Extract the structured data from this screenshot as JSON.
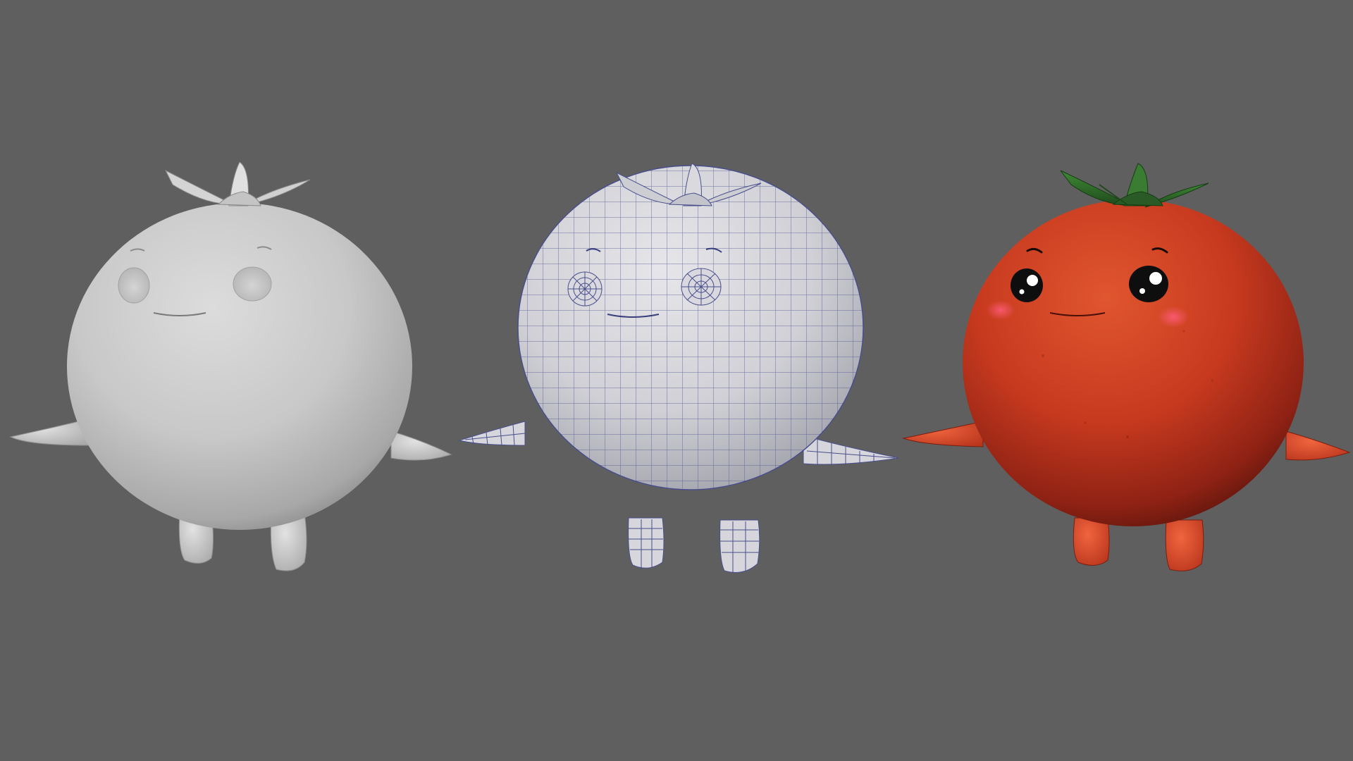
{
  "scene": {
    "background_color": "#5f5f5f",
    "characters": [
      {
        "name": "clay-render",
        "style": "shaded-gray",
        "body_color": "#c9c9c9",
        "limb_color": "#d6d6d6",
        "stem_color": "#cfcfcf"
      },
      {
        "name": "wireframe-render",
        "style": "wireframe",
        "body_color": "#d2d2d6",
        "wire_color": "#4a4f8c",
        "stem_color": "#cfcfd4"
      },
      {
        "name": "textured-render",
        "style": "textured",
        "body_color": "#c8321e",
        "limb_color": "#d8452a",
        "stem_color": "#2f6b2a",
        "blush_color": "#ff4f6e",
        "eye_color": "#111111"
      }
    ]
  }
}
